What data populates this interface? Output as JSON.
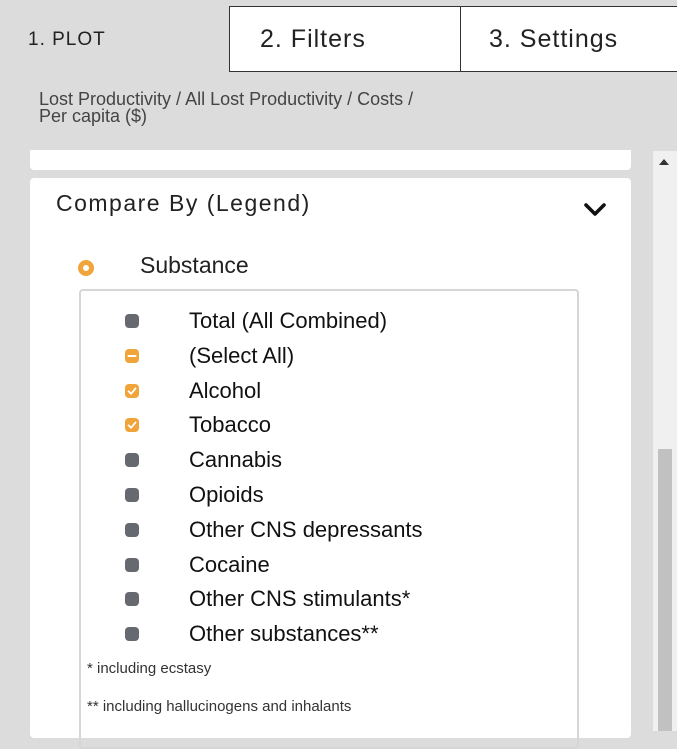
{
  "tabs": {
    "plot": "1. PLOT",
    "filters": "2. Filters",
    "settings": "3. Settings"
  },
  "breadcrumb": {
    "line1": "Lost Productivity / All Lost Productivity / Costs /",
    "line2": "Per capita ($)"
  },
  "compare": {
    "title": "Compare By (Legend)",
    "radio_label": "Substance",
    "chevron_icon": "chevron-down-icon",
    "accent_color": "#f0a43a",
    "unchecked_color": "#66696f"
  },
  "substances": [
    {
      "label": "Total (All Combined)",
      "state": "unchecked"
    },
    {
      "label": "(Select All)",
      "state": "partial"
    },
    {
      "label": "Alcohol",
      "state": "checked"
    },
    {
      "label": "Tobacco",
      "state": "checked"
    },
    {
      "label": "Cannabis",
      "state": "unchecked"
    },
    {
      "label": "Opioids",
      "state": "unchecked"
    },
    {
      "label": "Other CNS depressants",
      "state": "unchecked"
    },
    {
      "label": "Cocaine",
      "state": "unchecked"
    },
    {
      "label": "Other CNS stimulants*",
      "state": "unchecked"
    },
    {
      "label": "Other substances**",
      "state": "unchecked"
    }
  ],
  "footnotes": {
    "note1": "* including ecstasy",
    "note2": "** including hallucinogens and inhalants"
  }
}
